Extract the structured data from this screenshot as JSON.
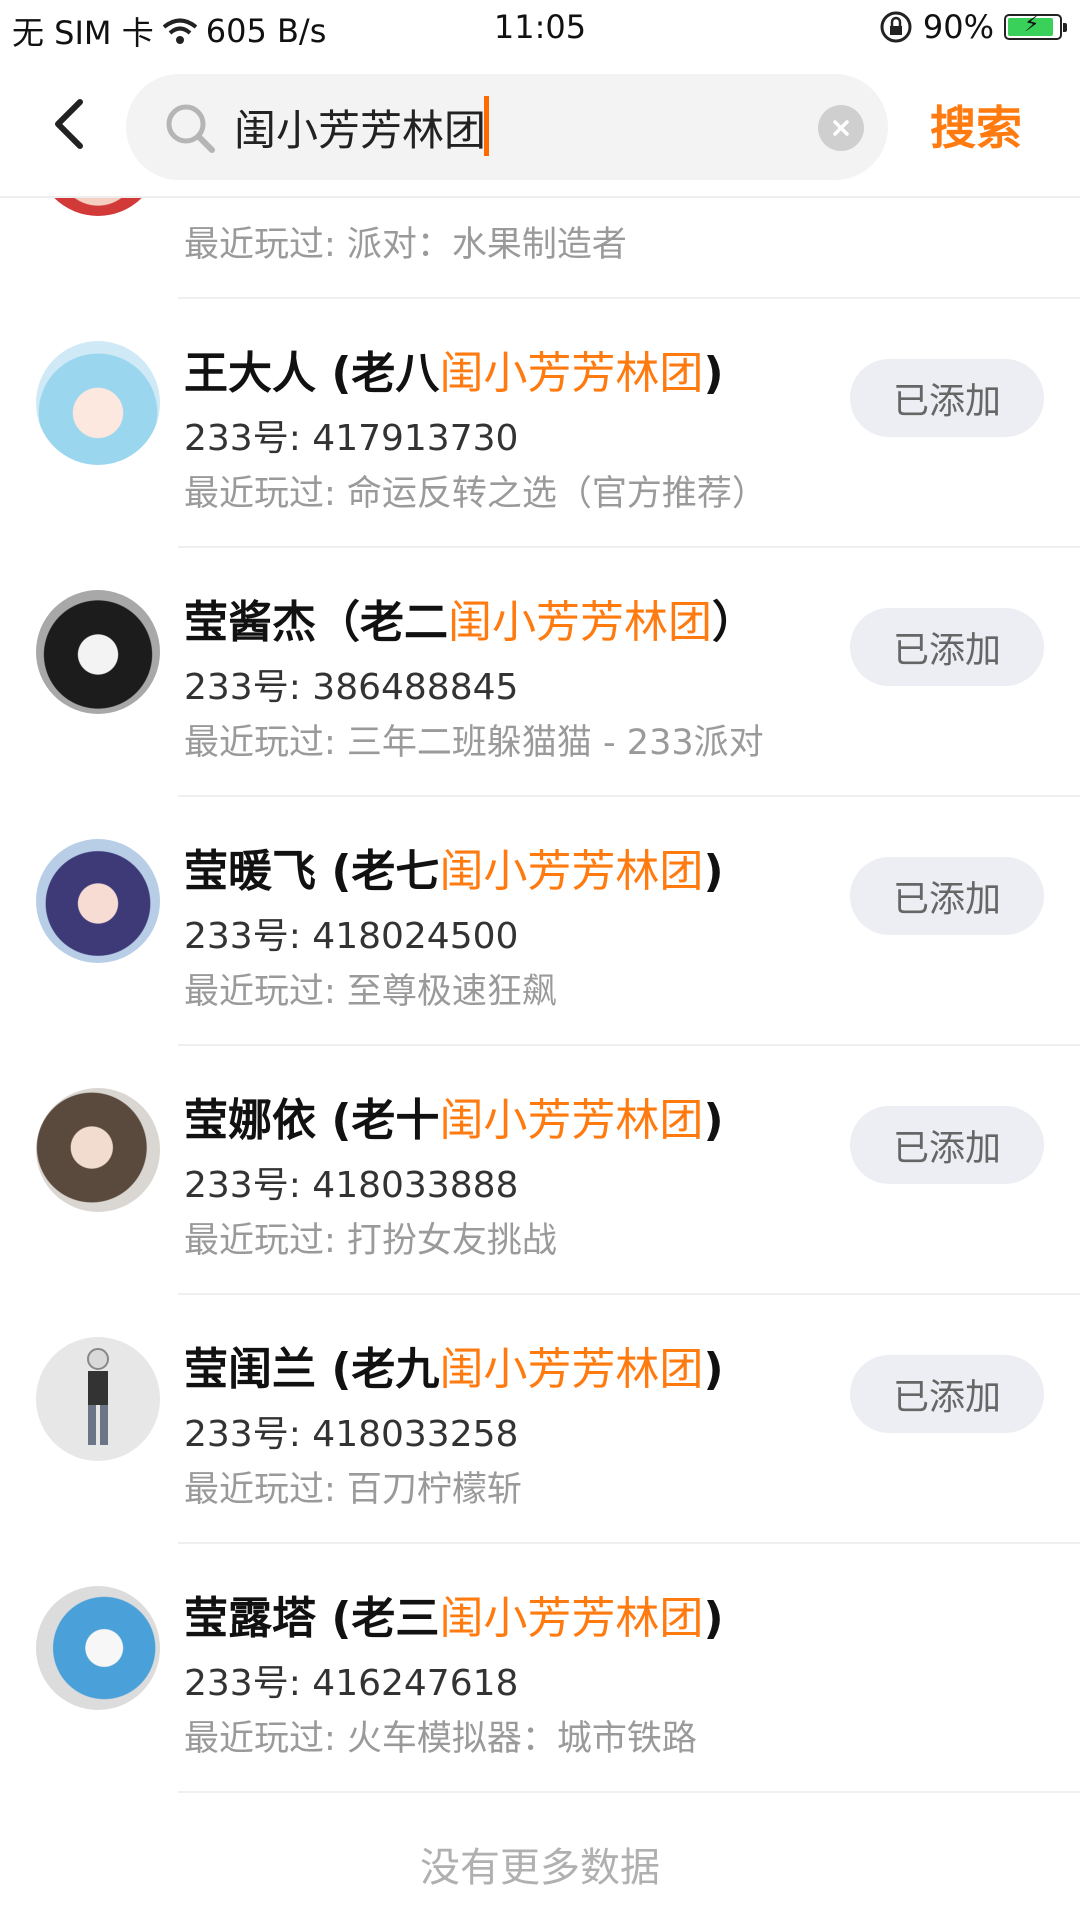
{
  "status_bar": {
    "carrier": "无 SIM 卡",
    "speed": "605 B/s",
    "time": "11:05",
    "battery": "90%",
    "battery_level": 0.9
  },
  "search": {
    "query": "闺小芳芳林团",
    "button_label": "搜索"
  },
  "results": [
    {
      "name_prefix": "",
      "name_highlight": "",
      "name_suffix": "",
      "uid": "",
      "recent": "最近玩过: 派对：水果制造者"
    },
    {
      "name_prefix": "王大人 (老八",
      "name_highlight": "闺小芳芳林团",
      "name_suffix": ")",
      "uid": "233号: 417913730",
      "recent": "最近玩过: 命运反转之选（官方推荐）",
      "button": "已添加"
    },
    {
      "name_prefix": "莹酱杰（老二",
      "name_highlight": "闺小芳芳林团",
      "name_suffix": "）",
      "uid": "233号: 386488845",
      "recent": "最近玩过: 三年二班躲猫猫 - 233派对",
      "button": "已添加"
    },
    {
      "name_prefix": "莹暖飞 (老七",
      "name_highlight": "闺小芳芳林团",
      "name_suffix": ")",
      "uid": "233号: 418024500",
      "recent": "最近玩过: 至尊极速狂飙",
      "button": "已添加"
    },
    {
      "name_prefix": "莹娜依 (老十",
      "name_highlight": "闺小芳芳林团",
      "name_suffix": ")",
      "uid": "233号: 418033888",
      "recent": "最近玩过: 打扮女友挑战",
      "button": "已添加"
    },
    {
      "name_prefix": "莹闺兰 (老九",
      "name_highlight": "闺小芳芳林团",
      "name_suffix": ")",
      "uid": "233号: 418033258",
      "recent": "最近玩过: 百刀柠檬斩",
      "button": "已添加"
    },
    {
      "name_prefix": "莹露塔 (老三",
      "name_highlight": "闺小芳芳林团",
      "name_suffix": ")",
      "uid": "233号: 416247618",
      "recent": "最近玩过: 火车模拟器：城市铁路"
    }
  ],
  "footer": "没有更多数据",
  "colors": {
    "accent": "#ff7a0f",
    "button_bg": "#eceef3"
  }
}
